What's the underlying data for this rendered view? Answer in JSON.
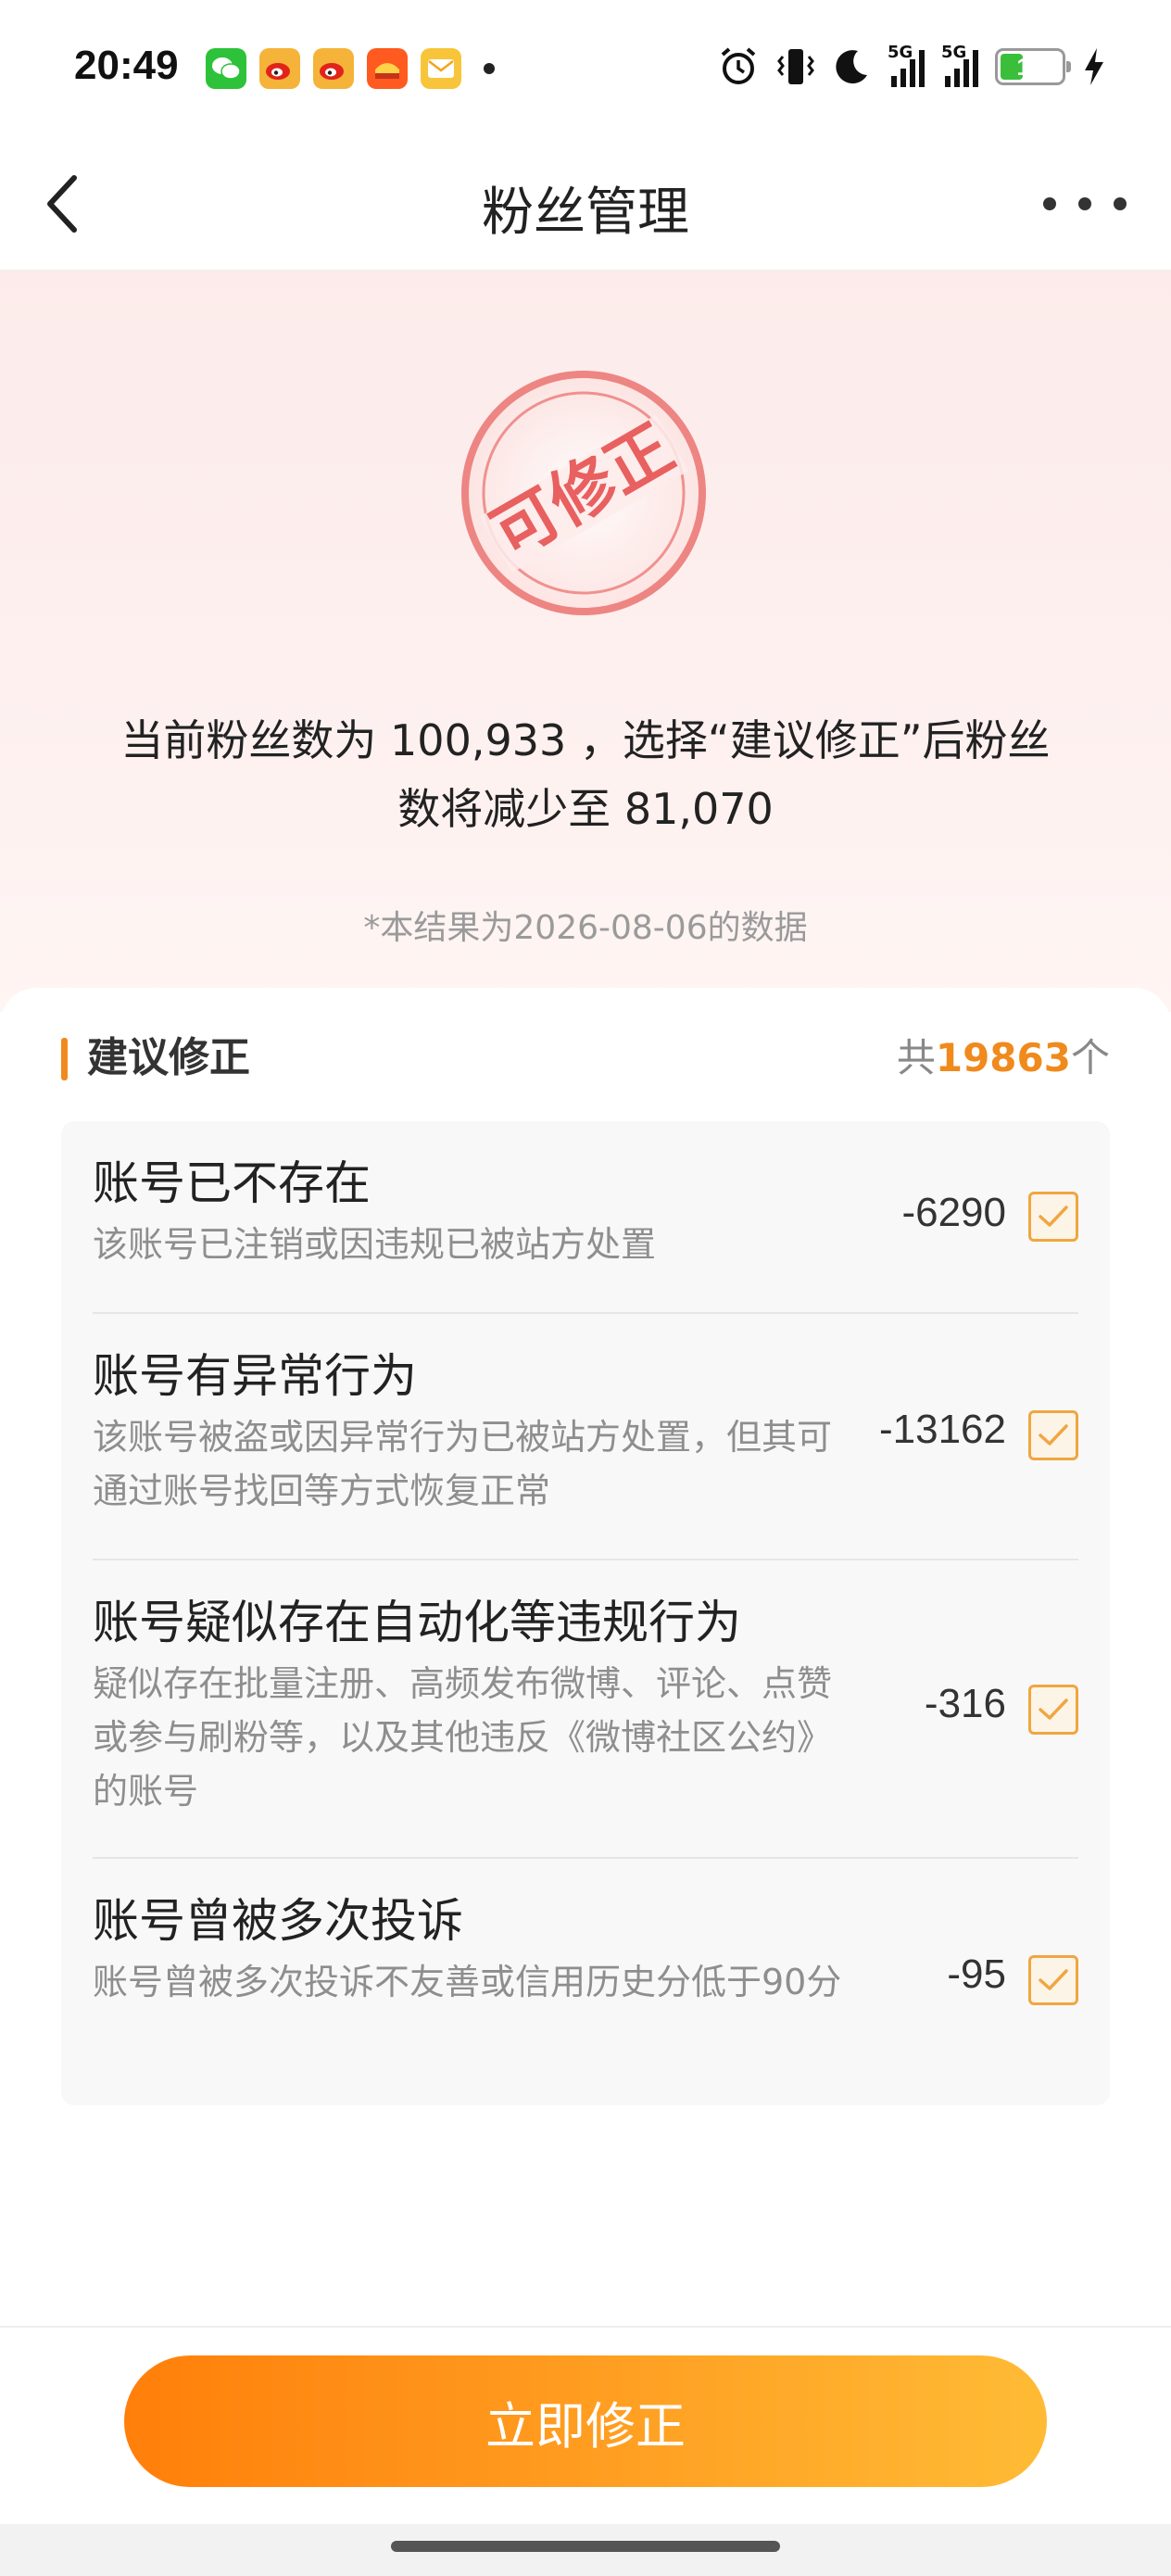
{
  "status_bar": {
    "time": "20:49",
    "battery_level": "18",
    "network_1": "5G",
    "network_2": "5G",
    "notification_icons": [
      "wechat-icon",
      "weibo-icon",
      "weibo-icon",
      "taobao-icon",
      "mail-icon"
    ],
    "system_icons": [
      "alarm-icon",
      "vibrate-icon",
      "moon-icon",
      "signal-icon",
      "signal-icon",
      "battery-icon",
      "charging-icon"
    ]
  },
  "nav": {
    "title": "粉丝管理"
  },
  "hero": {
    "stamp_text": "可修正",
    "summary_line_1": "当前粉丝数为 100,933 ，选择“建议修正”后粉丝",
    "summary_line_2": "数将减少至 81,070",
    "note": "*本结果为2026-08-06的数据"
  },
  "section": {
    "title": "建议修正",
    "count_prefix": "共",
    "count_value": "19863",
    "count_suffix": "个"
  },
  "items": [
    {
      "title": "账号已不存在",
      "desc": "该账号已注销或因违规已被站方处置",
      "value": "-6290",
      "checked": true
    },
    {
      "title": "账号有异常行为",
      "desc": "该账号被盗或因异常行为已被站方处置，但其可通过账号找回等方式恢复正常",
      "value": "-13162",
      "checked": true
    },
    {
      "title": "账号疑似存在自动化等违规行为",
      "desc": "疑似存在批量注册、高频发布微博、评论、点赞或参与刷粉等，以及其他违反《微博社区公约》的账号",
      "value": "-316",
      "checked": true
    },
    {
      "title": "账号曾被多次投诉",
      "desc": "账号曾被多次投诉不友善或信用历史分低于90分",
      "value": "-95",
      "checked": true
    }
  ],
  "action": {
    "button_label": "立即修正"
  },
  "colors": {
    "accent": "#f08a1c",
    "button_start": "#ff7f0a",
    "button_end": "#ffbb35",
    "stamp": "#e8605f",
    "hero_bg": "#fcebea"
  }
}
